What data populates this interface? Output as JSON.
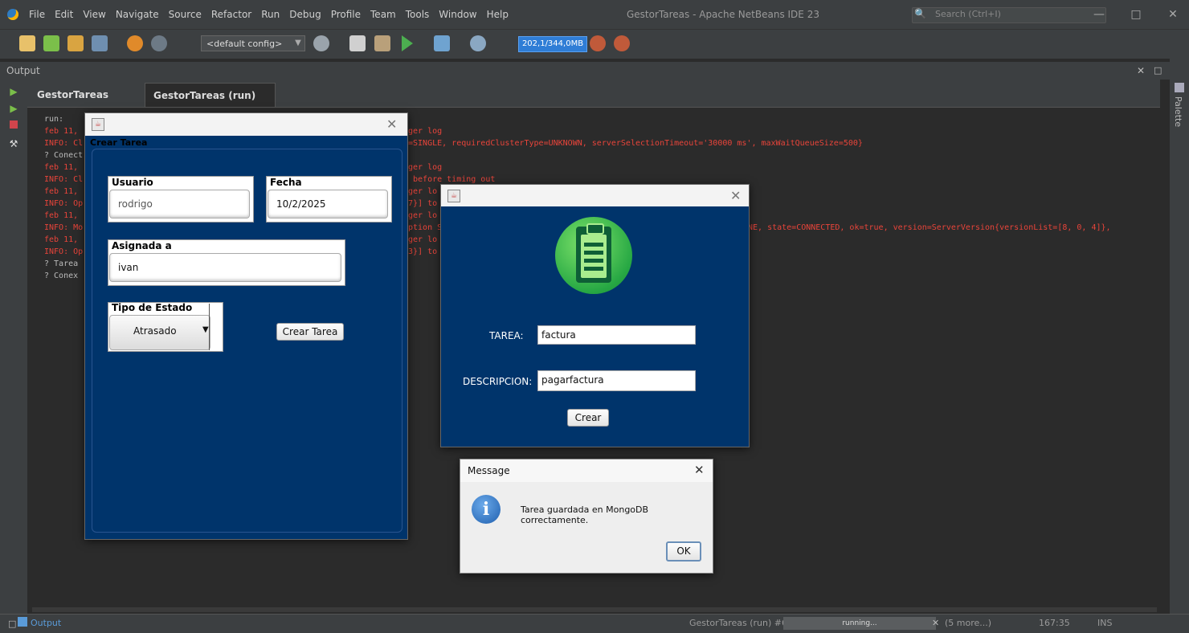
{
  "window": {
    "title": "GestorTareas - Apache NetBeans IDE 23",
    "search_placeholder": "Search (Ctrl+I)"
  },
  "menu": [
    "File",
    "Edit",
    "View",
    "Navigate",
    "Source",
    "Refactor",
    "Run",
    "Debug",
    "Profile",
    "Team",
    "Tools",
    "Window",
    "Help"
  ],
  "toolbar": {
    "config": "<default config>",
    "memory": "202,1/344,0MB"
  },
  "output": {
    "title": "Output",
    "tabs": [
      "GestorTareas (run)",
      "GestorTareas (run) #6"
    ],
    "tab_close": "×",
    "lines": [
      {
        "text": "run:",
        "color": "gray"
      },
      {
        "text": "feb 11,",
        "color": "red"
      },
      {
        "text": "INFO: Cl",
        "color": "red"
      },
      {
        "text": "? Conect",
        "color": "gray"
      },
      {
        "text": "feb 11,",
        "color": "red"
      },
      {
        "text": "INFO: Cl",
        "color": "red"
      },
      {
        "text": "feb 11,",
        "color": "red"
      },
      {
        "text": "INFO: Op",
        "color": "red"
      },
      {
        "text": "feb 11,",
        "color": "red"
      },
      {
        "text": "INFO: Mo",
        "color": "red"
      },
      {
        "text": "feb 11,",
        "color": "red"
      },
      {
        "text": "INFO: Op",
        "color": "red"
      },
      {
        "text": "? Tarea",
        "color": "gray"
      },
      {
        "text": "? Conex",
        "color": "gray"
      }
    ],
    "mid_lines": [
      {
        "text": "ger log",
        "row": 1
      },
      {
        "text": "=SINGLE, requiredClusterType=UNKNOWN, serverSelectionTimeout='30000 ms', maxWaitQueueSize=500}",
        "row": 2
      },
      {
        "text": "ger log",
        "row": 4
      },
      {
        "text": " before timing out",
        "row": 5
      },
      {
        "text": "ger lo",
        "row": 6
      },
      {
        "text": "7}] to",
        "row": 7
      },
      {
        "text": "ger lo",
        "row": 8
      },
      {
        "text": "ption S",
        "row": 9
      },
      {
        "text": "ger lo",
        "row": 10
      },
      {
        "text": "3}] to",
        "row": 11
      }
    ],
    "right_line": "NE, state=CONNECTED, ok=true, version=ServerVersion{versionList=[8, 0, 4]},"
  },
  "palette_label": "Palette",
  "status": {
    "output_button": "Output",
    "task": "GestorTareas (run) #6",
    "progress": "running...",
    "more": "(5 more...)",
    "position": "167:35",
    "mode": "INS"
  },
  "crear_tarea_window": {
    "panel_title": "Crear Tarea",
    "usuario_label": "Usuario",
    "usuario_value": "rodrigo",
    "fecha_label": "Fecha",
    "fecha_value": "10/2/2025",
    "asignada_label": "Asignada a",
    "asignada_value": "ivan",
    "estado_label": "Tipo de Estado",
    "estado_value": "Atrasado",
    "submit_label": "Crear Tarea"
  },
  "tarea_window": {
    "tarea_label": "TAREA:",
    "tarea_value": "factura",
    "descripcion_label": "DESCRIPCION:",
    "descripcion_value": "pagarfactura",
    "submit_label": "Crear"
  },
  "message_dialog": {
    "title": "Message",
    "text": "Tarea guardada en MongoDB correctamente.",
    "ok_label": "OK"
  },
  "colors": {
    "form_bg": "#00346b",
    "console_red": "#e8443a",
    "ide_bg": "#2b2b2b",
    "memory_blue": "#2f7dd6"
  }
}
